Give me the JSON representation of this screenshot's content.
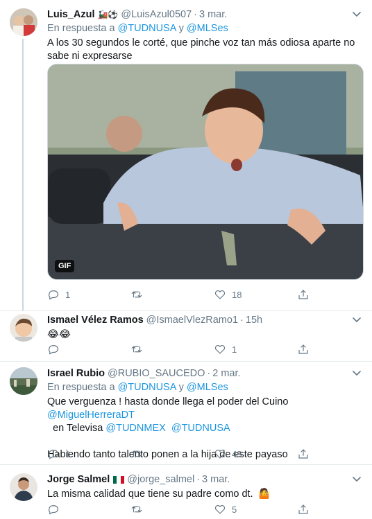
{
  "tweets": [
    {
      "name": "Luis_Azul",
      "handle": "@LuisAzul0507",
      "time": "3 mar.",
      "reply_prefix": "En respuesta a",
      "reply_to_1": "@TUDNUSA",
      "reply_and": "y",
      "reply_to_2": "@MLSes",
      "text": "A los 30 segundos le corté, que pinche voz tan más odiosa aparte no sabe ni expresarse",
      "media_badge": "GIF",
      "replies": "1",
      "retweets": "",
      "likes": "18"
    },
    {
      "name": "Ismael Vélez Ramos",
      "handle": "@IsmaelVlezRamo1",
      "time": "15h",
      "text": "😂😂",
      "replies": "",
      "retweets": "",
      "likes": "1"
    },
    {
      "name": "Israel Rubio",
      "handle": "@RUBIO_SAUCEDO",
      "time": "2 mar.",
      "reply_prefix": "En respuesta a",
      "reply_to_1": "@TUDNUSA",
      "reply_and": "y",
      "reply_to_2": "@MLSes",
      "text_line1_a": "Que verguenza ! hasta donde llega el poder del Cuino",
      "text_line1_link": "@MiguelHerreraDT",
      "text_line2_a": "en Televisa",
      "text_line2_link1": "@TUDNMEX",
      "text_line2_link2": "@TUDNUSA",
      "text_para2": "Habiendo tanto talento ponen a la hija de este payaso",
      "replies": "1",
      "retweets": "",
      "likes": "43"
    },
    {
      "name": "Jorge Salmel",
      "handle": "@jorge_salmel",
      "time": "3 mar.",
      "text": "La misma calidad que tiene su padre como dt.",
      "replies": "",
      "retweets": "",
      "likes": "5"
    }
  ],
  "colors": {
    "link": "#1b95e0",
    "secondary": "#657786",
    "divider": "#e6ecf0"
  }
}
